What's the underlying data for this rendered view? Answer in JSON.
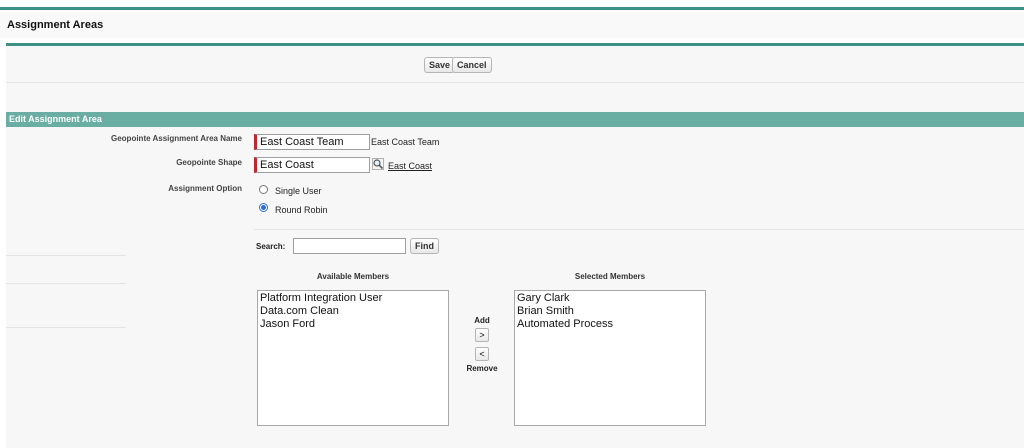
{
  "page": {
    "title": "Assignment Areas"
  },
  "toolbar": {
    "save_label": "Save",
    "cancel_label": "Cancel"
  },
  "section": {
    "title": "Edit Assignment Area"
  },
  "form": {
    "area_name": {
      "label": "Geopointe Assignment Area Name",
      "value": "East Coast Team",
      "display": "East Coast Team"
    },
    "shape": {
      "label": "Geopointe Shape",
      "value": "East Coast",
      "link": "East Coast",
      "icon": "lookup-magnifier-icon"
    },
    "assignment_option": {
      "label": "Assignment Option",
      "options": [
        {
          "label": "Single User",
          "selected": false
        },
        {
          "label": "Round Robin",
          "selected": true
        }
      ]
    }
  },
  "search": {
    "label": "Search:",
    "value": "",
    "button": "Find"
  },
  "members": {
    "available": {
      "heading": "Available Members",
      "items": [
        "Platform Integration User",
        "Data.com Clean",
        "Jason Ford"
      ]
    },
    "selected": {
      "heading": "Selected Members",
      "items": [
        "Gary Clark",
        "Brian Smith",
        "Automated Process"
      ]
    },
    "add_label": "Add",
    "add_button": ">",
    "remove_button": "<",
    "remove_label": "Remove"
  }
}
